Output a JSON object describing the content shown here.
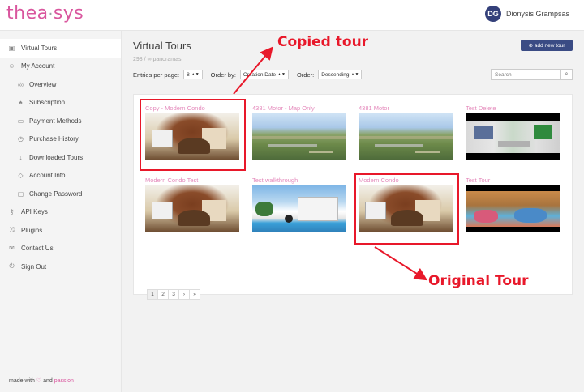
{
  "app": {
    "logo": "thea",
    "logo_dot": "·",
    "logo_tail": "sys"
  },
  "user": {
    "initials": "DG",
    "name": "Dionysis Grampsas"
  },
  "sidebar": {
    "items": [
      {
        "label": "Virtual Tours",
        "icon": "map-icon",
        "icon_glyph": "▣",
        "level": "top",
        "active": true
      },
      {
        "label": "My Account",
        "icon": "user-icon",
        "icon_glyph": "☺",
        "level": "top"
      },
      {
        "label": "Overview",
        "icon": "eye-icon",
        "icon_glyph": "◎",
        "level": "sub"
      },
      {
        "label": "Subscription",
        "icon": "trophy-icon",
        "icon_glyph": "♠",
        "level": "sub"
      },
      {
        "label": "Payment Methods",
        "icon": "credit-card-icon",
        "icon_glyph": "▭",
        "level": "sub"
      },
      {
        "label": "Purchase History",
        "icon": "history-icon",
        "icon_glyph": "◷",
        "level": "sub"
      },
      {
        "label": "Downloaded Tours",
        "icon": "download-icon",
        "icon_glyph": "↓",
        "level": "sub"
      },
      {
        "label": "Account Info",
        "icon": "tag-icon",
        "icon_glyph": "◇",
        "level": "sub"
      },
      {
        "label": "Change Password",
        "icon": "lock-icon",
        "icon_glyph": "▢",
        "level": "sub"
      },
      {
        "label": "API Keys",
        "icon": "key-icon",
        "icon_glyph": "⚷",
        "level": "top"
      },
      {
        "label": "Plugins",
        "icon": "shuffle-icon",
        "icon_glyph": "⤨",
        "level": "top"
      },
      {
        "label": "Contact Us",
        "icon": "mail-icon",
        "icon_glyph": "✉",
        "level": "top"
      },
      {
        "label": "Sign Out",
        "icon": "power-icon",
        "icon_glyph": "⏻",
        "level": "top"
      }
    ],
    "footer": {
      "prefix": "made with",
      "heart": "♡",
      "and": "and",
      "passion": "passion"
    }
  },
  "main": {
    "title": "Virtual Tours",
    "count": "298 / ∞ panoramas",
    "add_button": "⊕  add new tour",
    "entries_label": "Entries per page:",
    "entries_value": "8",
    "order_by_label": "Order by:",
    "order_by_value": "Creation Date",
    "order_label": "Order:",
    "order_value": "Descending",
    "search_placeholder": "Search",
    "search_icon_glyph": "⌕"
  },
  "tours": [
    {
      "name": "Copy - Modern Condo",
      "thumb": "condo"
    },
    {
      "name": "4381 Motor - Map Only",
      "thumb": "aerial"
    },
    {
      "name": "4381 Motor",
      "thumb": "aerial"
    },
    {
      "name": "Test Delete",
      "thumb": "store"
    },
    {
      "name": "Modern Condo Test",
      "thumb": "condo"
    },
    {
      "name": "Test walkthrough",
      "thumb": "pool"
    },
    {
      "name": "Modern Condo",
      "thumb": "condo"
    },
    {
      "name": "Test Tour",
      "thumb": "crowd"
    }
  ],
  "pagination": [
    "1",
    "2",
    "3",
    "›",
    "»"
  ],
  "annotations": {
    "copied": "Copied tour",
    "original": "Original Tour",
    "color": "#e8182a"
  },
  "colors": {
    "brand": "#d9569e",
    "accent": "#3a4b84"
  }
}
